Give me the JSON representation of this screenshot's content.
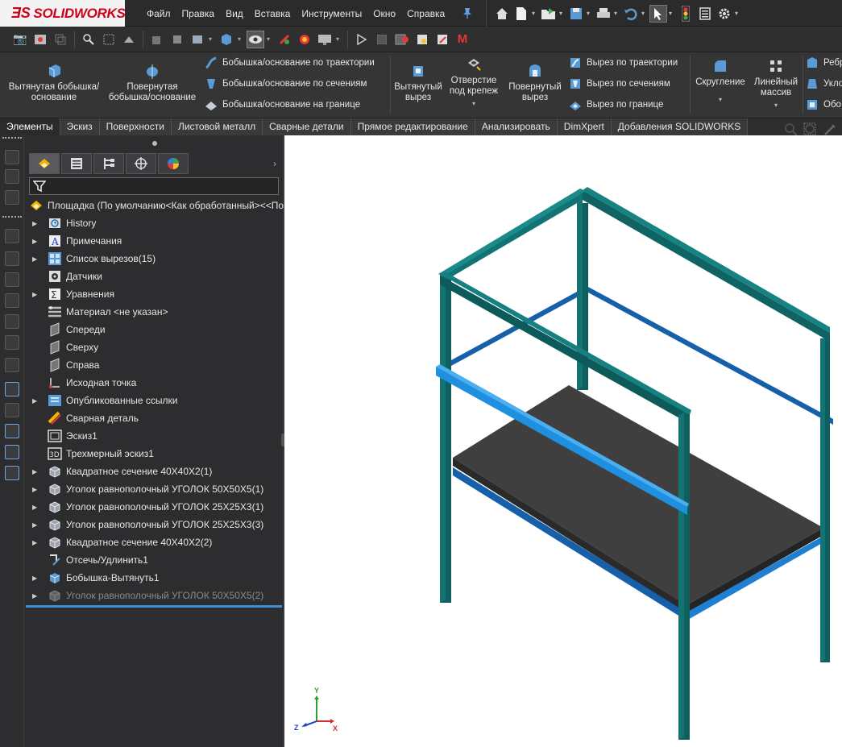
{
  "app": {
    "brand": "SOLIDWORKS"
  },
  "menu": [
    "Файл",
    "Правка",
    "Вид",
    "Вставка",
    "Инструменты",
    "Окно",
    "Справка"
  ],
  "ribbon": {
    "extruded_boss": "Вытянутая бобышка/основание",
    "revolved_boss": "Повернутая бобышка/основание",
    "swept_boss": "Бобышка/основание по траектории",
    "lofted_boss": "Бобышка/основание по сечениям",
    "boundary_boss": "Бобышка/основание на границе",
    "extruded_cut": "Вытянутый вырез",
    "hole_wizard": "Отверстие под крепеж",
    "revolved_cut": "Повернутый вырез",
    "swept_cut": "Вырез по траектории",
    "lofted_cut": "Вырез по сечениям",
    "boundary_cut": "Вырез по границе",
    "fillet": "Скругление",
    "linear_pattern": "Линейный массив",
    "rib": "Ребр",
    "draft": "Укло",
    "shell": "Обо"
  },
  "tabs": [
    "Элементы",
    "Эскиз",
    "Поверхности",
    "Листовой металл",
    "Сварные детали",
    "Прямое редактирование",
    "Анализировать",
    "DimXpert",
    "Добавления SOLIDWORKS"
  ],
  "tree": {
    "root": "Площадка  (По умолчанию<Как обработанный><<По",
    "items": [
      {
        "label": "History",
        "expandable": true,
        "icon": "history-icon"
      },
      {
        "label": "Примечания",
        "expandable": true,
        "icon": "annotations-icon"
      },
      {
        "label": "Список вырезов(15)",
        "expandable": true,
        "icon": "cut-list-icon"
      },
      {
        "label": "Датчики",
        "expandable": false,
        "icon": "sensors-icon"
      },
      {
        "label": "Уравнения",
        "expandable": true,
        "icon": "equations-icon"
      },
      {
        "label": "Материал <не указан>",
        "expandable": false,
        "icon": "material-icon"
      },
      {
        "label": "Спереди",
        "expandable": false,
        "icon": "plane-icon"
      },
      {
        "label": "Сверху",
        "expandable": false,
        "icon": "plane-icon"
      },
      {
        "label": "Справа",
        "expandable": false,
        "icon": "plane-icon"
      },
      {
        "label": "Исходная точка",
        "expandable": false,
        "icon": "origin-icon"
      },
      {
        "label": "Опубликованные ссылки",
        "expandable": true,
        "icon": "published-references-icon"
      },
      {
        "label": "Сварная деталь",
        "expandable": false,
        "icon": "weldment-icon"
      },
      {
        "label": "Эскиз1",
        "expandable": false,
        "icon": "sketch-icon"
      },
      {
        "label": "Трехмерный эскиз1",
        "expandable": false,
        "icon": "3d-sketch-icon"
      },
      {
        "label": "Квадратное сечение 40X40X2(1)",
        "expandable": true,
        "icon": "structural-member-icon"
      },
      {
        "label": "Уголок равнополочный УГОЛОК 50X50X5(1)",
        "expandable": true,
        "icon": "structural-member-icon"
      },
      {
        "label": "Уголок равнополочный УГОЛОК 25X25X3(1)",
        "expandable": true,
        "icon": "structural-member-icon"
      },
      {
        "label": "Уголок равнополочный УГОЛОК 25X25X3(3)",
        "expandable": true,
        "icon": "structural-member-icon"
      },
      {
        "label": "Квадратное сечение 40X40X2(2)",
        "expandable": true,
        "icon": "structural-member-icon"
      },
      {
        "label": "Отсечь/Удлинить1",
        "expandable": false,
        "icon": "trim-extend-icon"
      },
      {
        "label": "Бобышка-Вытянуть1",
        "expandable": true,
        "icon": "extrude-icon"
      },
      {
        "label": "Уголок равнополочный УГОЛОК 50X50X5(2)",
        "expandable": true,
        "icon": "structural-member-icon",
        "suppressed": true
      }
    ]
  },
  "triad": {
    "x": "X",
    "y": "Y",
    "z": "Z"
  },
  "colors": {
    "frame": "#136f6f",
    "frame_dark": "#0b4a4a",
    "bar": "#1f8fe0",
    "bar_dark": "#1560a8",
    "plate": "#3f3f3f",
    "accent_blue": "#3b8fd9"
  }
}
